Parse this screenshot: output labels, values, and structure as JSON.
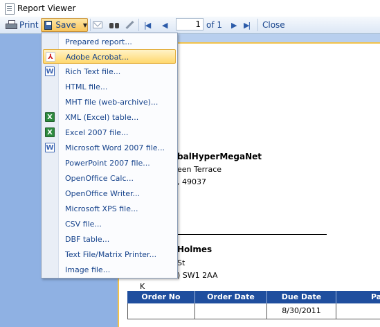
{
  "window": {
    "title": "Report Viewer"
  },
  "toolbar": {
    "print_label": "Print",
    "save_label": "Save",
    "page_current": "1",
    "page_of": "of 1",
    "close_label": "Close"
  },
  "save_menu": {
    "items": [
      {
        "label": "Prepared report...",
        "icon": ""
      },
      {
        "label": "Adobe Acrobat...",
        "icon": "pdf-icon",
        "highlighted": true
      },
      {
        "label": "Rich Text file...",
        "icon": "word-icon"
      },
      {
        "label": "HTML file...",
        "icon": ""
      },
      {
        "label": "MHT file (web-archive)...",
        "icon": ""
      },
      {
        "label": "XML (Excel) table...",
        "icon": "excel-icon"
      },
      {
        "label": "Excel 2007 file...",
        "icon": "excel-icon"
      },
      {
        "label": "Microsoft Word 2007 file...",
        "icon": "word-icon"
      },
      {
        "label": "PowerPoint 2007 file...",
        "icon": ""
      },
      {
        "label": "OpenOffice Calc...",
        "icon": ""
      },
      {
        "label": "OpenOffice Writer...",
        "icon": ""
      },
      {
        "label": "Microsoft XPS file...",
        "icon": ""
      },
      {
        "label": "CSV file...",
        "icon": ""
      },
      {
        "label": "DBF table...",
        "icon": ""
      },
      {
        "label": "Text File/Matrix Printer...",
        "icon": ""
      },
      {
        "label": "Image file...",
        "icon": ""
      }
    ]
  },
  "document": {
    "company_name_fragment": "balHyperMegaNet",
    "address_line1_fragment": "een Terrace",
    "address_line2_fragment": ",  49037",
    "customer_name_fragment": "Holmes",
    "customer_line1_fragment": "St",
    "customer_line2_fragment": ") SW1 2AA",
    "customer_line3_fragment": "K",
    "table_headers": [
      "Order No",
      "Order Date",
      "Due Date",
      "Pa"
    ],
    "table_rows": [
      [
        "",
        "",
        "8/30/2011",
        ""
      ]
    ]
  },
  "colors": {
    "left_panel": "#8fb1e3",
    "doc_background": "#b8cfee",
    "table_header": "#1f4e9e",
    "menu_highlight": "#ffd86e"
  }
}
